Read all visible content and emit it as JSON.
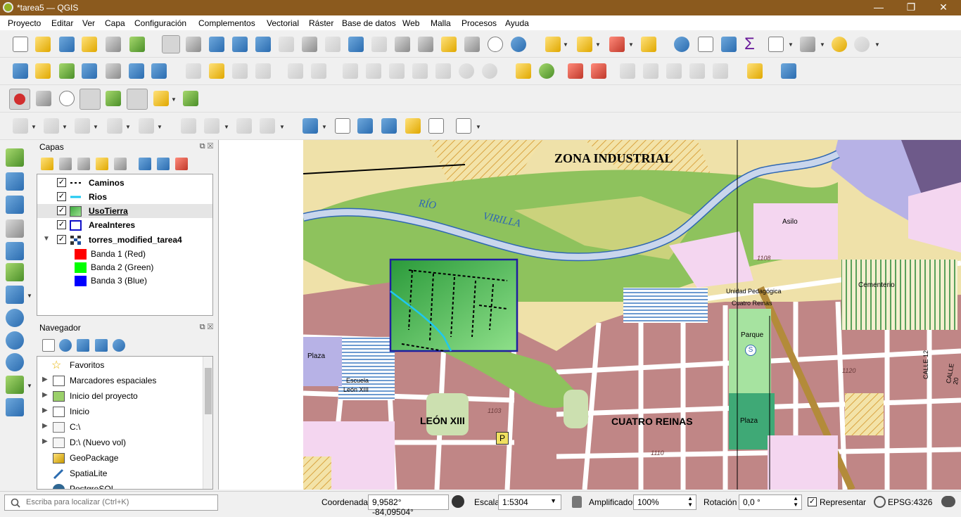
{
  "window": {
    "title": "*tarea5 — QGIS",
    "controls": [
      "—",
      "❐",
      "✕"
    ]
  },
  "menu": [
    "Proyecto",
    "Editar",
    "Ver",
    "Capa",
    "Configuración",
    "Complementos",
    "Vectorial",
    "Ráster",
    "Base de datos",
    "Web",
    "Malla",
    "Procesos",
    "Ayuda"
  ],
  "layers_panel": {
    "title": "Capas",
    "layers": [
      {
        "name": "Caminos",
        "checked": true,
        "symbol": "dashed-line"
      },
      {
        "name": "Rios",
        "checked": true,
        "symbol": "cyan-line"
      },
      {
        "name": "UsoTierra",
        "checked": true,
        "symbol": "green-fill",
        "selected": true
      },
      {
        "name": "AreaInteres",
        "checked": true,
        "symbol": "blue-outline"
      },
      {
        "name": "torres_modified_tarea4",
        "checked": true,
        "symbol": "raster",
        "expanded": true
      }
    ],
    "bands": [
      {
        "name": "Banda 1 (Red)",
        "color": "#ff0000"
      },
      {
        "name": "Banda 2 (Green)",
        "color": "#00ff00"
      },
      {
        "name": "Banda 3 (Blue)",
        "color": "#0000ff"
      }
    ]
  },
  "browser_panel": {
    "title": "Navegador",
    "items": [
      {
        "label": "Favoritos",
        "icon": "star-icon",
        "expandable": false
      },
      {
        "label": "Marcadores espaciales",
        "icon": "bookmark-icon",
        "expandable": true
      },
      {
        "label": "Inicio del proyecto",
        "icon": "project-home-icon",
        "expandable": true
      },
      {
        "label": "Inicio",
        "icon": "home-icon",
        "expandable": true
      },
      {
        "label": "C:\\",
        "icon": "folder-icon",
        "expandable": true
      },
      {
        "label": "D:\\ (Nuevo vol)",
        "icon": "folder-icon",
        "expandable": true
      },
      {
        "label": "GeoPackage",
        "icon": "geopackage-icon",
        "expandable": false
      },
      {
        "label": "SpatiaLite",
        "icon": "spatialite-icon",
        "expandable": false
      },
      {
        "label": "PostgreSQL",
        "icon": "postgresql-icon",
        "expandable": false
      }
    ]
  },
  "map": {
    "labels": {
      "zona_industrial": "ZONA INDUSTRIAL",
      "rio": "RÍO",
      "virilla": "VIRILLA",
      "leon_xiii": "LEÓN XIII",
      "cuatro_reinas": "CUATRO REINAS",
      "cementerio": "Cementerio",
      "parque": "Parque",
      "plaza_1": "Plaza",
      "plaza_2": "Plaza",
      "asilo": "Asilo",
      "unidad": "Unidad Pedagógica",
      "cuatro_reinas_small": "Cuatro Reinas",
      "escuela": "Escuela",
      "leon_small": "León XIII",
      "calle_12": "CALLE 12",
      "calle_20": "CALLE 20",
      "num_1103": "1103",
      "num_1110": "1110",
      "num_1120": "1120",
      "num_1108": "1108"
    },
    "colors": {
      "residential": "#c08686",
      "road": "#ffffff",
      "river": "#c9d6ec",
      "green_zone": "#8ec25d",
      "bg": "#efe1a9",
      "aoi_outline": "#1e1ea0"
    }
  },
  "status": {
    "locator_placeholder": "Escriba para localizar (Ctrl+K)",
    "coord_label": "Coordenada",
    "coord_value": "9,9582° -84,09504°",
    "scale_label": "Escala",
    "scale_value": "1:5304",
    "magnifier_label": "Amplificador",
    "magnifier_value": "100%",
    "rotation_label": "Rotación",
    "rotation_value": "0,0 °",
    "render_label": "Representar",
    "crs": "EPSG:4326"
  }
}
